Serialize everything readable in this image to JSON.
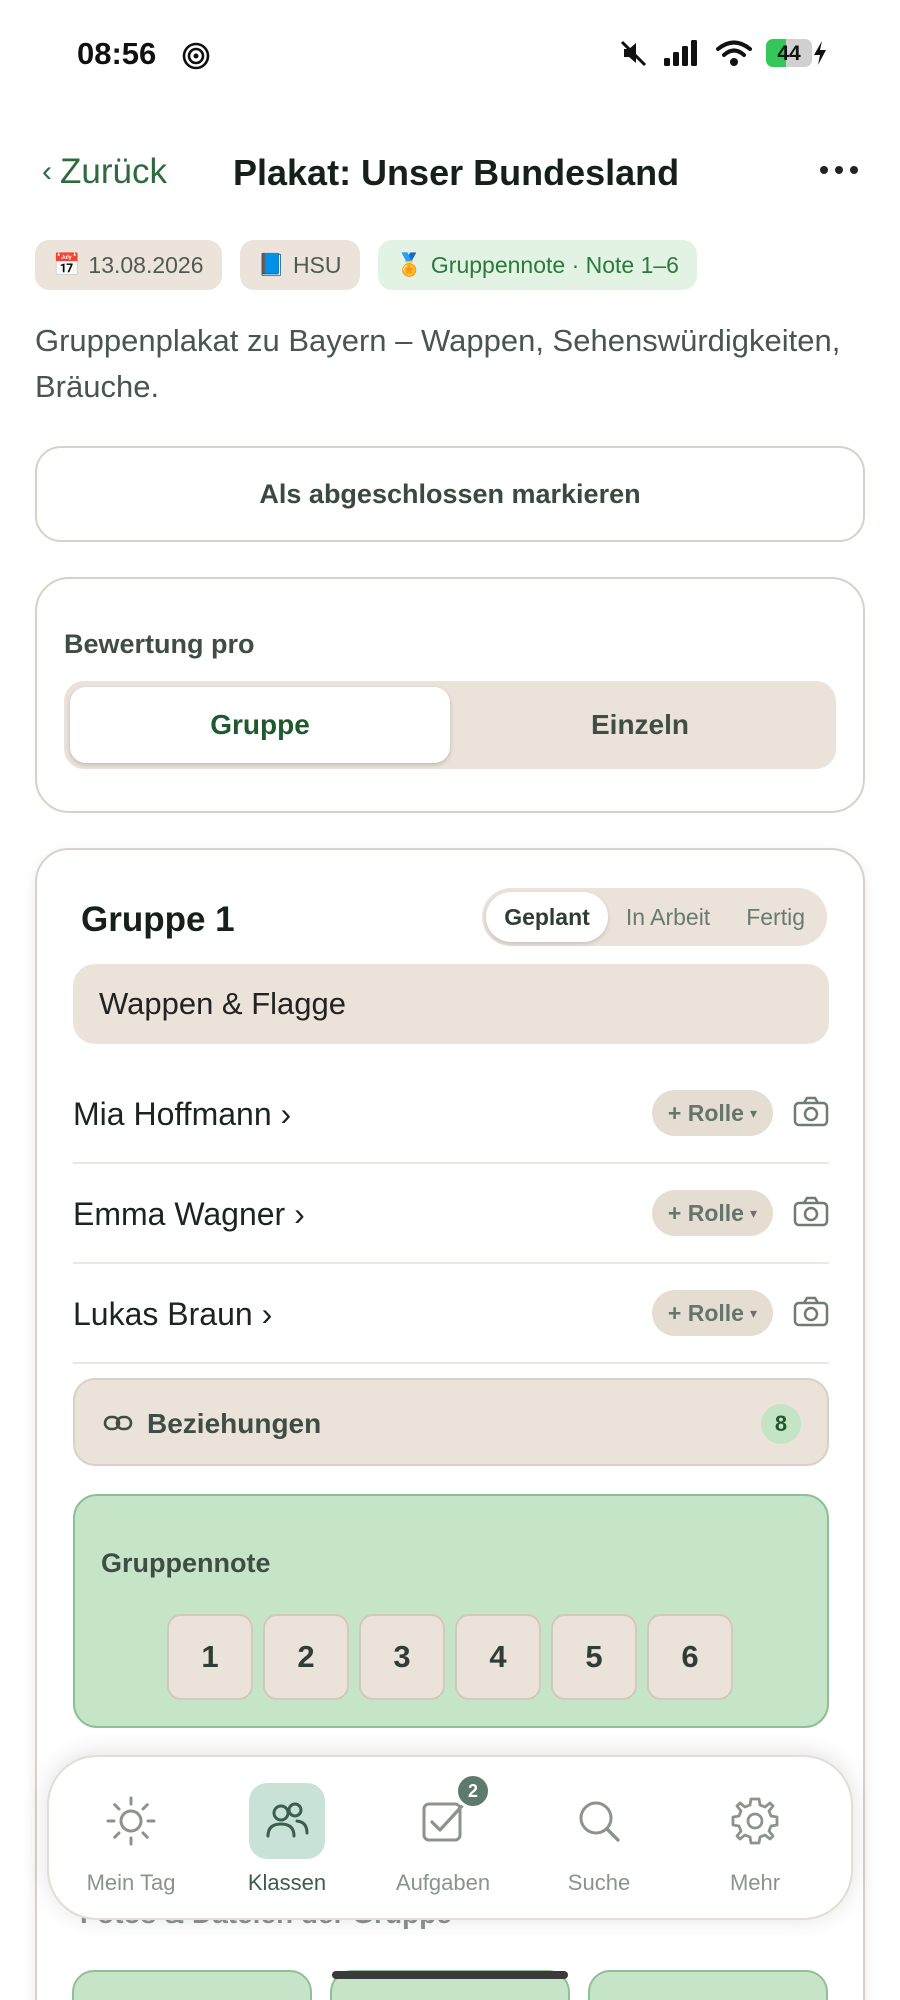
{
  "status_bar": {
    "time": "08:56",
    "battery": "44"
  },
  "header": {
    "back_label": "Zurück",
    "title": "Plakat: Unser Bundesland"
  },
  "chips": [
    {
      "icon": "📅",
      "label": "13.08.2026"
    },
    {
      "icon": "📘",
      "label": "HSU"
    },
    {
      "icon": "🏅",
      "label": "Gruppennote · Note 1–6"
    }
  ],
  "description": "Gruppenplakat zu Bayern – Wappen, Sehenswürdigkeiten, Bräuche.",
  "complete_button": "Als abgeschlossen markieren",
  "bewertung": {
    "label": "Bewertung pro",
    "options": [
      "Gruppe",
      "Einzeln"
    ],
    "selected": "Gruppe"
  },
  "group": {
    "title": "Gruppe 1",
    "status_options": [
      "Geplant",
      "In Arbeit",
      "Fertig"
    ],
    "status_selected": "Geplant",
    "topic": "Wappen & Flagge",
    "role_label": "+ Rolle",
    "members": [
      {
        "name": "Mia Hoffmann ›"
      },
      {
        "name": "Emma Wagner ›"
      },
      {
        "name": "Lukas Braun ›"
      }
    ],
    "relations_label": "Beziehungen",
    "relations_count": "8",
    "grade_label": "Gruppennote",
    "grades": [
      "1",
      "2",
      "3",
      "4",
      "5",
      "6"
    ],
    "files_label": "Fotos & Dateien der Gruppe"
  },
  "tabbar": {
    "tabs": [
      {
        "label": "Mein Tag",
        "icon": "sun-icon"
      },
      {
        "label": "Klassen",
        "icon": "users-icon"
      },
      {
        "label": "Aufgaben",
        "icon": "checkbox-icon",
        "badge": "2"
      },
      {
        "label": "Suche",
        "icon": "search-icon"
      },
      {
        "label": "Mehr",
        "icon": "gear-icon"
      }
    ],
    "active": "Klassen"
  }
}
